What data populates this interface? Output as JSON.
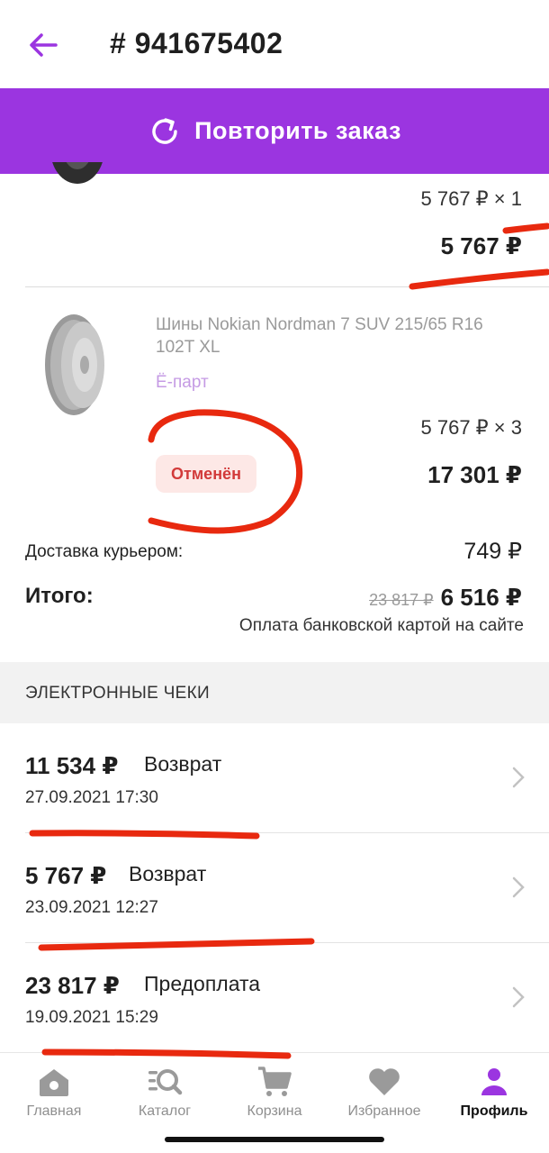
{
  "header": {
    "title": "# 941675402",
    "back_icon": "arrow-left-icon"
  },
  "repeat_order": {
    "label": "Повторить заказ",
    "icon": "refresh-icon",
    "color": "#9b35e0"
  },
  "item1": {
    "unit_price": "5 767 ₽ × 1",
    "sum": "5 767 ₽"
  },
  "item2": {
    "name": "Шины Nokian Nordman 7 SUV 215/65 R16 102T XL",
    "seller": "Ё-парт",
    "unit_price": "5 767 ₽ × 3",
    "status": "Отменён",
    "sum": "17 301 ₽"
  },
  "delivery": {
    "label": "Доставка курьером:",
    "price": "749 ₽"
  },
  "total": {
    "label": "Итого:",
    "old": "23 817 ₽",
    "new": "6 516 ₽",
    "payment": "Оплата банковской картой на сайте"
  },
  "receipts": {
    "title": "ЭЛЕКТРОННЫЕ ЧЕКИ",
    "items": [
      {
        "amount": "11 534 ₽",
        "type": "Возврат",
        "date": "27.09.2021 17:30"
      },
      {
        "amount": "5 767 ₽",
        "type": "Возврат",
        "date": "23.09.2021 12:27"
      },
      {
        "amount": "23 817 ₽",
        "type": "Предоплата",
        "date": "19.09.2021 15:29"
      }
    ]
  },
  "tabs": [
    {
      "label": "Главная",
      "icon": "home-icon"
    },
    {
      "label": "Каталог",
      "icon": "catalog-search-icon"
    },
    {
      "label": "Корзина",
      "icon": "cart-icon"
    },
    {
      "label": "Избранное",
      "icon": "heart-icon"
    },
    {
      "label": "Профиль",
      "icon": "profile-icon",
      "active": true
    }
  ],
  "colors": {
    "accent": "#9b35e0",
    "annotation": "#e8290f",
    "status_bg": "#fde8e6",
    "status_text": "#d23a3a"
  }
}
